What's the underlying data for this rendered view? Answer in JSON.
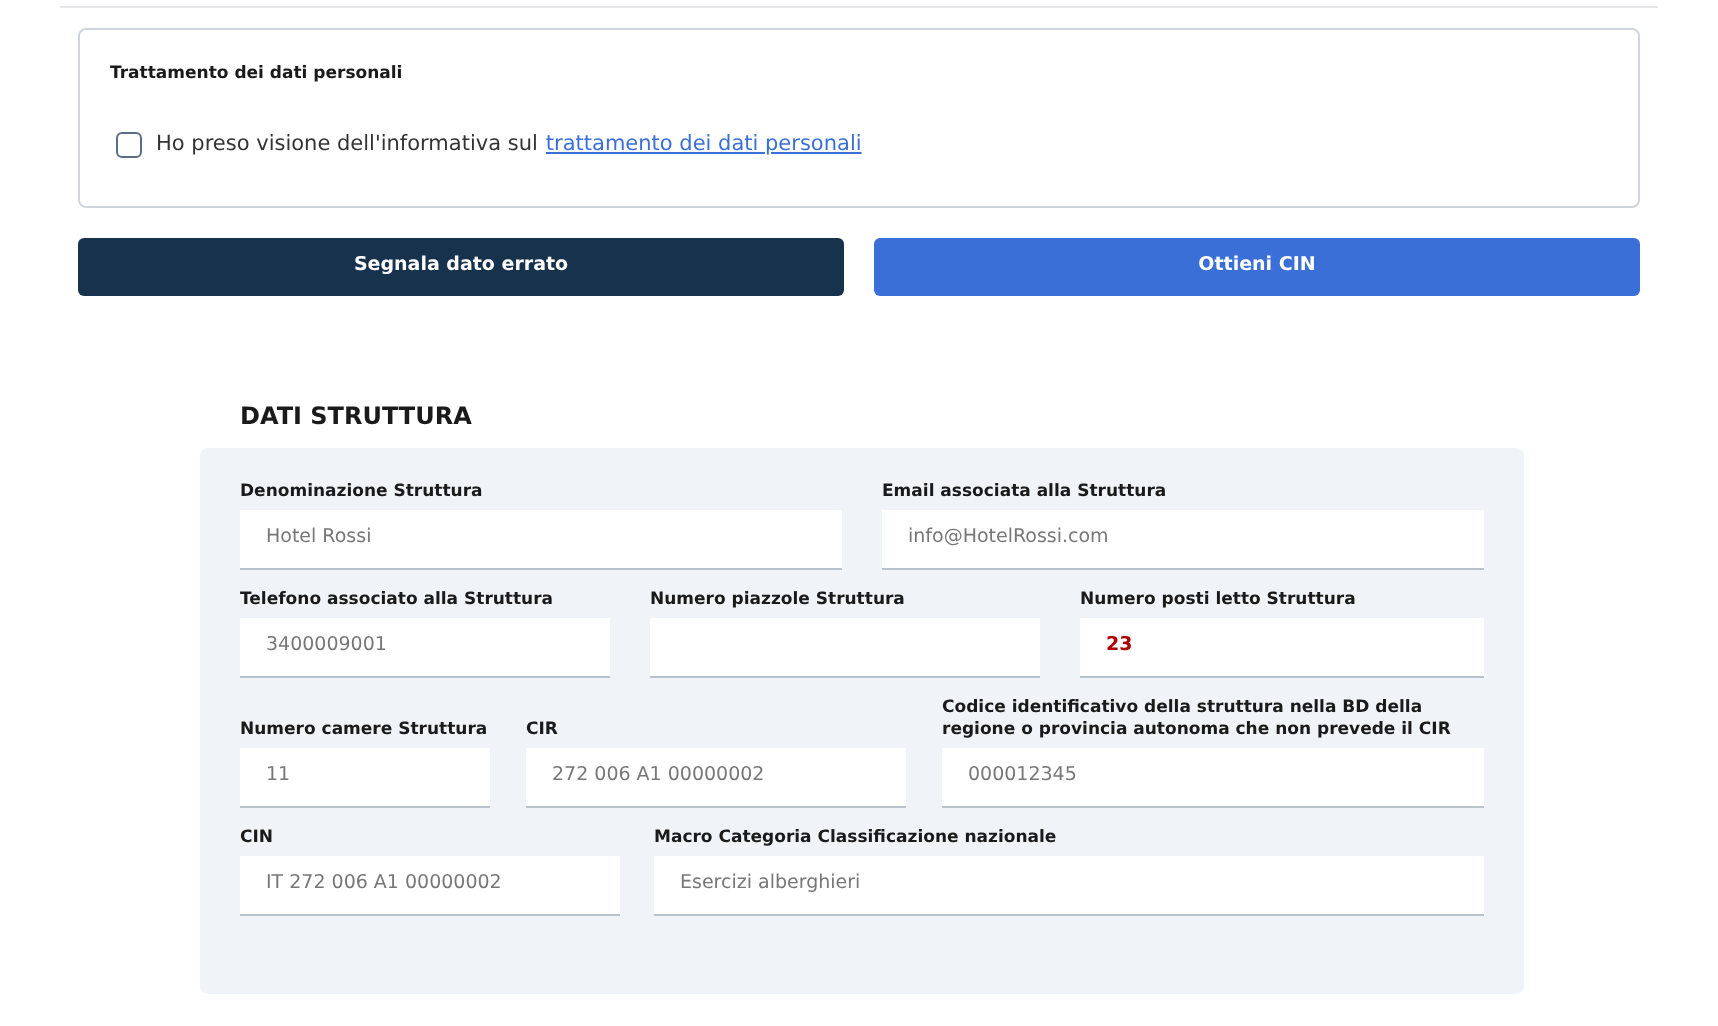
{
  "consent": {
    "title": "Trattamento dei dati personali",
    "checkbox": {
      "checked": false,
      "text": "Ho preso visione dell'informativa sul",
      "link": "trattamento dei dati personali"
    }
  },
  "buttons": [
    {
      "label": "Segnala dato errato",
      "kind": "secondary"
    },
    {
      "label": "Ottieni CIN",
      "kind": "primary"
    }
  ],
  "section": {
    "title": "DATI STRUTTURA",
    "rows": [
      {
        "fields": [
          {
            "label": "Denominazione Struttura",
            "value": "Hotel Rossi",
            "kind": "plain"
          },
          {
            "label": "Email associata alla Struttura",
            "value": "info@HotelRossi.com",
            "kind": "plain"
          }
        ]
      },
      {
        "fields": [
          {
            "label": "Telefono associato alla Struttura",
            "value": "3400009001",
            "kind": "plain"
          },
          {
            "label": "Numero piazzole Struttura",
            "kind": "plain"
          },
          {
            "label": "Numero posti letto Struttura",
            "value": "23",
            "kind": "highlighted"
          }
        ]
      },
      {
        "fields": [
          {
            "label": "Numero camere Struttura",
            "value": "11",
            "kind": "plain"
          },
          {
            "label": "CIR",
            "value": "272 006 A1 00000002",
            "kind": "plain"
          },
          {
            "label": "Codice identificativo della struttura nella BD della regione o provincia autonoma che non prevede il CIR",
            "value": "000012345",
            "kind": "plain"
          }
        ]
      },
      {
        "fields": [
          {
            "label": "CIN",
            "value": "IT 272 006 A1 00000002",
            "kind": "plain"
          },
          {
            "label": "Macro Categoria Classificazione nazionale",
            "value": "Esercizi alberghieri",
            "kind": "plain"
          }
        ]
      }
    ]
  }
}
